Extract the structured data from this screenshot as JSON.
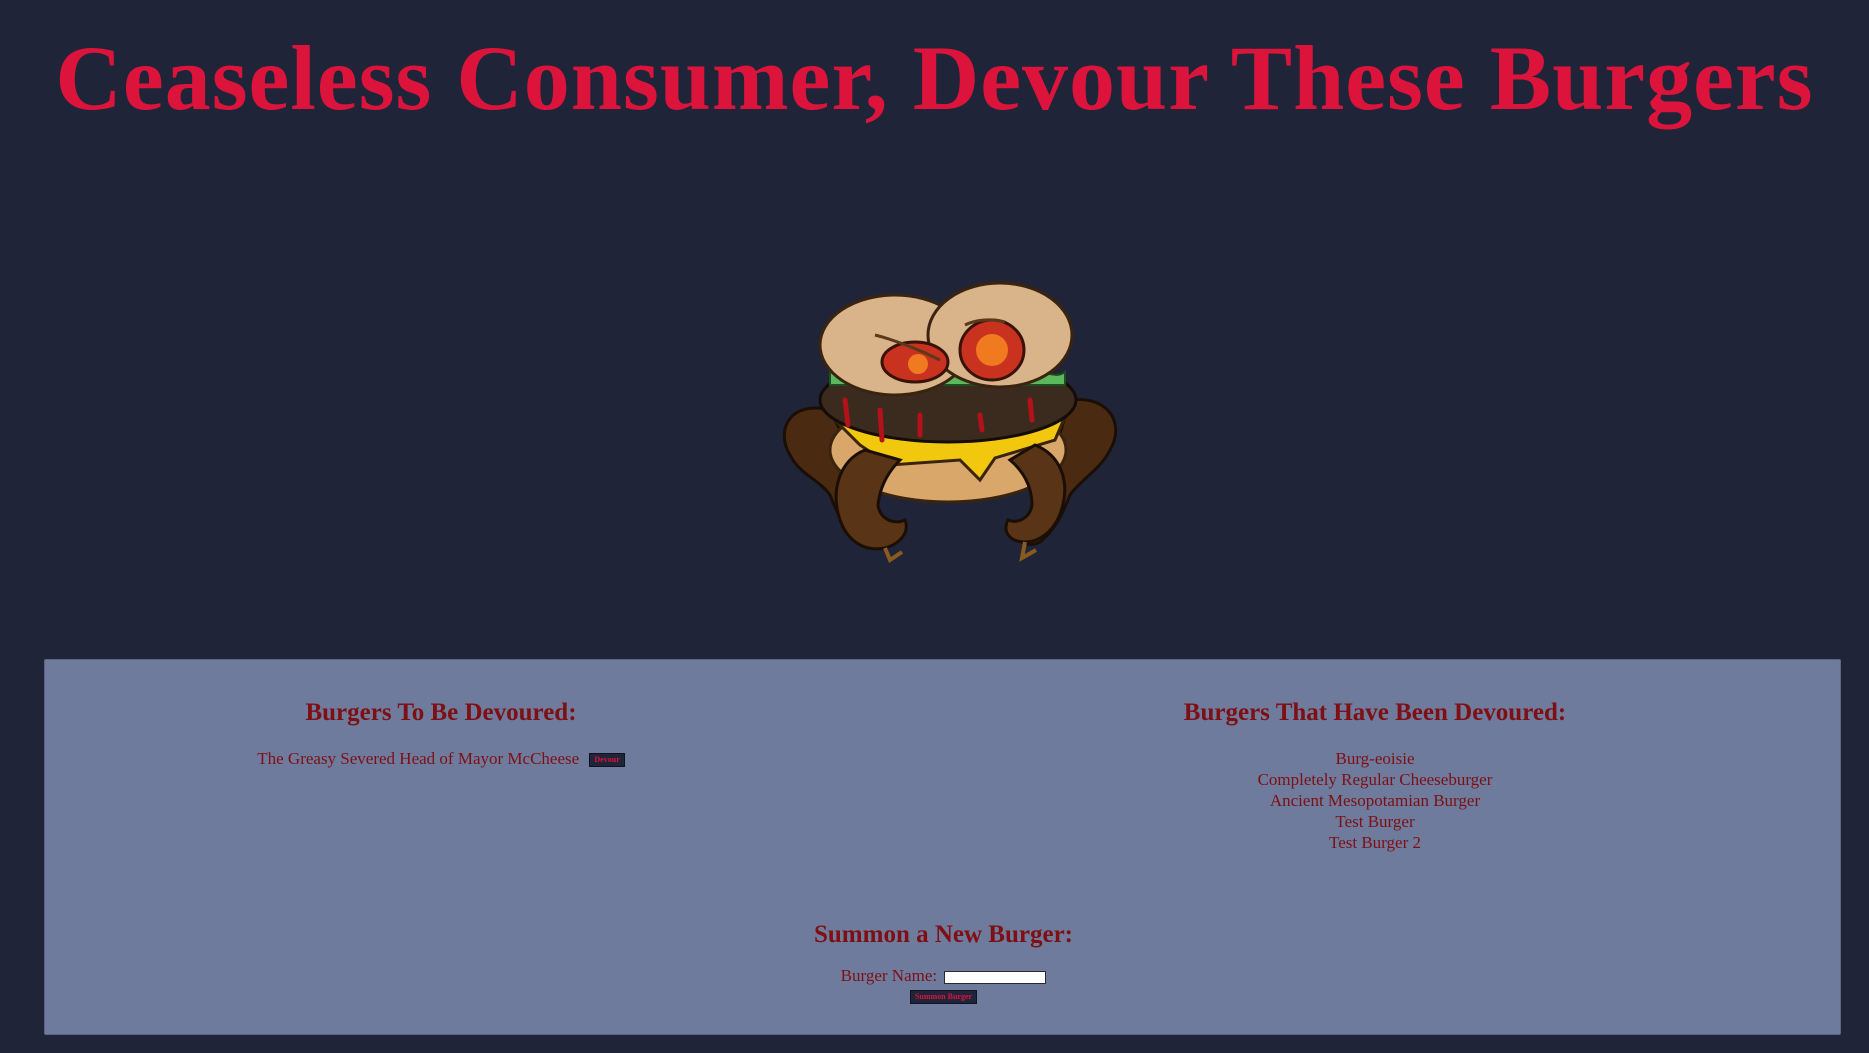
{
  "page": {
    "title": "Ceaseless Consumer, Devour These Burgers"
  },
  "hero": {
    "image": "burger-monster-icon"
  },
  "to_devour": {
    "heading": "Burgers To Be Devoured:",
    "items": [
      {
        "name": "The Greasy Severed Head of Mayor McCheese",
        "button_label": "Devour"
      }
    ]
  },
  "devoured": {
    "heading": "Burgers That Have Been Devoured:",
    "items": [
      "Burg-eoisie",
      "Completely Regular Cheeseburger",
      "Ancient Mesopotamian Burger",
      "Test Burger",
      "Test Burger 2"
    ]
  },
  "summon": {
    "heading": "Summon a New Burger:",
    "field_label": "Burger Name:",
    "field_value": "",
    "button_label": "Summon Burger"
  },
  "colors": {
    "background": "#1f2438",
    "title": "#dc143c",
    "panel": "#6e7b9d",
    "text": "#7e0f13"
  }
}
